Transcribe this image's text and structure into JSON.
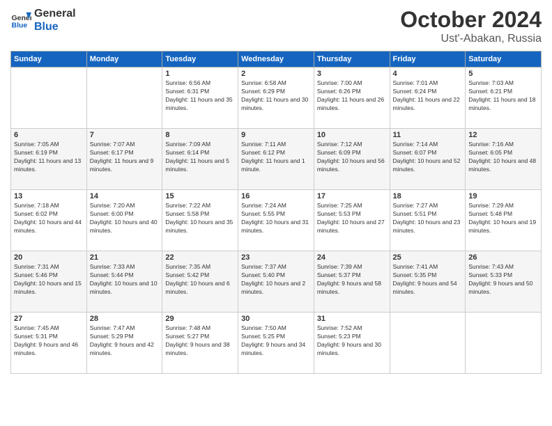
{
  "header": {
    "logo_general": "General",
    "logo_blue": "Blue",
    "month_title": "October 2024",
    "location": "Ust'-Abakan, Russia"
  },
  "weekdays": [
    "Sunday",
    "Monday",
    "Tuesday",
    "Wednesday",
    "Thursday",
    "Friday",
    "Saturday"
  ],
  "weeks": [
    [
      {
        "day": "",
        "sunrise": "",
        "sunset": "",
        "daylight": ""
      },
      {
        "day": "",
        "sunrise": "",
        "sunset": "",
        "daylight": ""
      },
      {
        "day": "1",
        "sunrise": "Sunrise: 6:56 AM",
        "sunset": "Sunset: 6:31 PM",
        "daylight": "Daylight: 11 hours and 35 minutes."
      },
      {
        "day": "2",
        "sunrise": "Sunrise: 6:58 AM",
        "sunset": "Sunset: 6:29 PM",
        "daylight": "Daylight: 11 hours and 30 minutes."
      },
      {
        "day": "3",
        "sunrise": "Sunrise: 7:00 AM",
        "sunset": "Sunset: 6:26 PM",
        "daylight": "Daylight: 11 hours and 26 minutes."
      },
      {
        "day": "4",
        "sunrise": "Sunrise: 7:01 AM",
        "sunset": "Sunset: 6:24 PM",
        "daylight": "Daylight: 11 hours and 22 minutes."
      },
      {
        "day": "5",
        "sunrise": "Sunrise: 7:03 AM",
        "sunset": "Sunset: 6:21 PM",
        "daylight": "Daylight: 11 hours and 18 minutes."
      }
    ],
    [
      {
        "day": "6",
        "sunrise": "Sunrise: 7:05 AM",
        "sunset": "Sunset: 6:19 PM",
        "daylight": "Daylight: 11 hours and 13 minutes."
      },
      {
        "day": "7",
        "sunrise": "Sunrise: 7:07 AM",
        "sunset": "Sunset: 6:17 PM",
        "daylight": "Daylight: 11 hours and 9 minutes."
      },
      {
        "day": "8",
        "sunrise": "Sunrise: 7:09 AM",
        "sunset": "Sunset: 6:14 PM",
        "daylight": "Daylight: 11 hours and 5 minutes."
      },
      {
        "day": "9",
        "sunrise": "Sunrise: 7:11 AM",
        "sunset": "Sunset: 6:12 PM",
        "daylight": "Daylight: 11 hours and 1 minute."
      },
      {
        "day": "10",
        "sunrise": "Sunrise: 7:12 AM",
        "sunset": "Sunset: 6:09 PM",
        "daylight": "Daylight: 10 hours and 56 minutes."
      },
      {
        "day": "11",
        "sunrise": "Sunrise: 7:14 AM",
        "sunset": "Sunset: 6:07 PM",
        "daylight": "Daylight: 10 hours and 52 minutes."
      },
      {
        "day": "12",
        "sunrise": "Sunrise: 7:16 AM",
        "sunset": "Sunset: 6:05 PM",
        "daylight": "Daylight: 10 hours and 48 minutes."
      }
    ],
    [
      {
        "day": "13",
        "sunrise": "Sunrise: 7:18 AM",
        "sunset": "Sunset: 6:02 PM",
        "daylight": "Daylight: 10 hours and 44 minutes."
      },
      {
        "day": "14",
        "sunrise": "Sunrise: 7:20 AM",
        "sunset": "Sunset: 6:00 PM",
        "daylight": "Daylight: 10 hours and 40 minutes."
      },
      {
        "day": "15",
        "sunrise": "Sunrise: 7:22 AM",
        "sunset": "Sunset: 5:58 PM",
        "daylight": "Daylight: 10 hours and 35 minutes."
      },
      {
        "day": "16",
        "sunrise": "Sunrise: 7:24 AM",
        "sunset": "Sunset: 5:55 PM",
        "daylight": "Daylight: 10 hours and 31 minutes."
      },
      {
        "day": "17",
        "sunrise": "Sunrise: 7:25 AM",
        "sunset": "Sunset: 5:53 PM",
        "daylight": "Daylight: 10 hours and 27 minutes."
      },
      {
        "day": "18",
        "sunrise": "Sunrise: 7:27 AM",
        "sunset": "Sunset: 5:51 PM",
        "daylight": "Daylight: 10 hours and 23 minutes."
      },
      {
        "day": "19",
        "sunrise": "Sunrise: 7:29 AM",
        "sunset": "Sunset: 5:48 PM",
        "daylight": "Daylight: 10 hours and 19 minutes."
      }
    ],
    [
      {
        "day": "20",
        "sunrise": "Sunrise: 7:31 AM",
        "sunset": "Sunset: 5:46 PM",
        "daylight": "Daylight: 10 hours and 15 minutes."
      },
      {
        "day": "21",
        "sunrise": "Sunrise: 7:33 AM",
        "sunset": "Sunset: 5:44 PM",
        "daylight": "Daylight: 10 hours and 10 minutes."
      },
      {
        "day": "22",
        "sunrise": "Sunrise: 7:35 AM",
        "sunset": "Sunset: 5:42 PM",
        "daylight": "Daylight: 10 hours and 6 minutes."
      },
      {
        "day": "23",
        "sunrise": "Sunrise: 7:37 AM",
        "sunset": "Sunset: 5:40 PM",
        "daylight": "Daylight: 10 hours and 2 minutes."
      },
      {
        "day": "24",
        "sunrise": "Sunrise: 7:39 AM",
        "sunset": "Sunset: 5:37 PM",
        "daylight": "Daylight: 9 hours and 58 minutes."
      },
      {
        "day": "25",
        "sunrise": "Sunrise: 7:41 AM",
        "sunset": "Sunset: 5:35 PM",
        "daylight": "Daylight: 9 hours and 54 minutes."
      },
      {
        "day": "26",
        "sunrise": "Sunrise: 7:43 AM",
        "sunset": "Sunset: 5:33 PM",
        "daylight": "Daylight: 9 hours and 50 minutes."
      }
    ],
    [
      {
        "day": "27",
        "sunrise": "Sunrise: 7:45 AM",
        "sunset": "Sunset: 5:31 PM",
        "daylight": "Daylight: 9 hours and 46 minutes."
      },
      {
        "day": "28",
        "sunrise": "Sunrise: 7:47 AM",
        "sunset": "Sunset: 5:29 PM",
        "daylight": "Daylight: 9 hours and 42 minutes."
      },
      {
        "day": "29",
        "sunrise": "Sunrise: 7:48 AM",
        "sunset": "Sunset: 5:27 PM",
        "daylight": "Daylight: 9 hours and 38 minutes."
      },
      {
        "day": "30",
        "sunrise": "Sunrise: 7:50 AM",
        "sunset": "Sunset: 5:25 PM",
        "daylight": "Daylight: 9 hours and 34 minutes."
      },
      {
        "day": "31",
        "sunrise": "Sunrise: 7:52 AM",
        "sunset": "Sunset: 5:23 PM",
        "daylight": "Daylight: 9 hours and 30 minutes."
      },
      {
        "day": "",
        "sunrise": "",
        "sunset": "",
        "daylight": ""
      },
      {
        "day": "",
        "sunrise": "",
        "sunset": "",
        "daylight": ""
      }
    ]
  ]
}
